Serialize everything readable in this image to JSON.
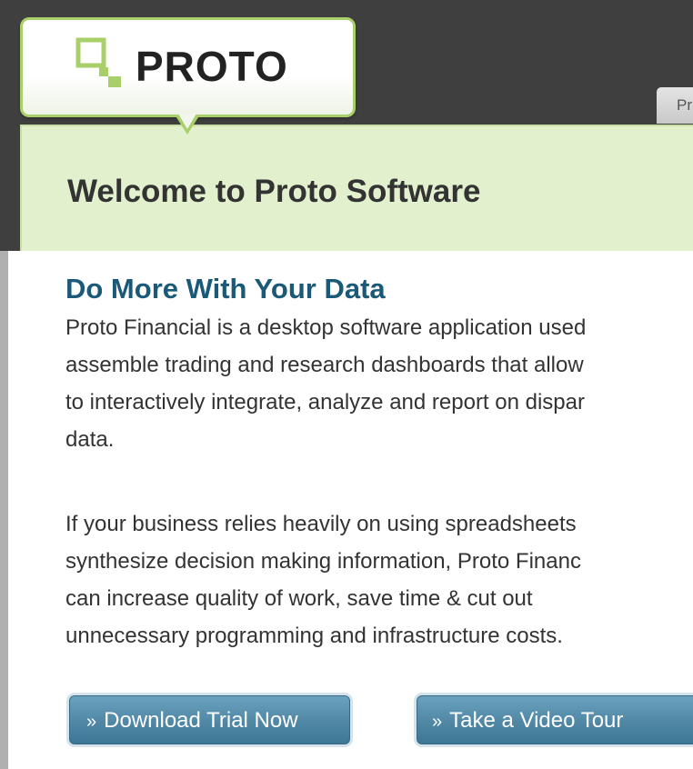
{
  "header": {
    "logo_text": "PROTO",
    "nav_tab_label": "Pr"
  },
  "hero": {
    "title": "Welcome to Proto Software"
  },
  "content": {
    "section_title": "Do More With Your Data",
    "paragraph_1_lines": [
      "Proto Financial is a desktop software application used",
      "assemble trading and research dashboards that allow",
      "to interactively integrate, analyze and report on dispar",
      "data."
    ],
    "paragraph_2_lines": [
      "If your business relies heavily on using spreadsheets",
      "synthesize decision making information, Proto Financ",
      "can increase quality of work, save time & cut out",
      "unnecessary programming and infrastructure costs."
    ]
  },
  "buttons": {
    "chevron": "»",
    "download_label": "Download Trial Now",
    "tour_label": "Take a Video Tour"
  },
  "colors": {
    "header_bg": "#3f3f3f",
    "hero_bg": "#e2f0cd",
    "accent_green": "#a9cf6b",
    "title_blue": "#1a5a78",
    "button_blue": "#4f87a5"
  }
}
